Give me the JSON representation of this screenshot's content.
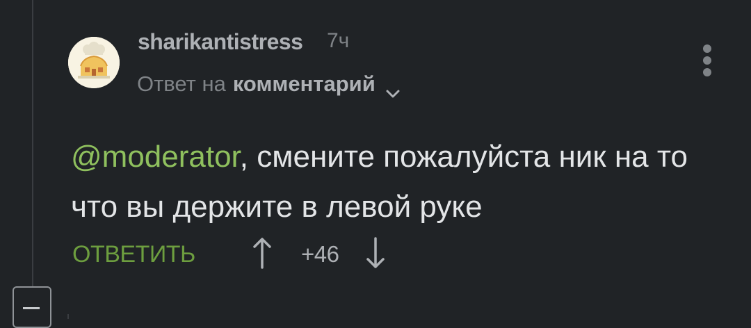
{
  "comment": {
    "author": "sharikantistress",
    "time": "7ч",
    "reply_prefix": "Ответ на",
    "reply_target": "комментарий",
    "mention": "@moderator",
    "text_after_mention": ", смените пожалуйста ник на то что вы держите в левой руке",
    "reply_button": "ОТВЕТИТЬ",
    "score": "+46"
  },
  "icons": {
    "avatar": "cartoon-house-avatar-icon",
    "more": "more-vertical-icon",
    "chevron": "chevron-down-icon",
    "upvote": "arrow-up-icon",
    "downvote": "arrow-down-icon",
    "collapse": "minus-square-icon"
  },
  "colors": {
    "background": "#202326",
    "mention": "#8fc05e",
    "reply_button": "#6d9e3f",
    "text": "#e3e5e7",
    "muted": "#7f8387"
  }
}
